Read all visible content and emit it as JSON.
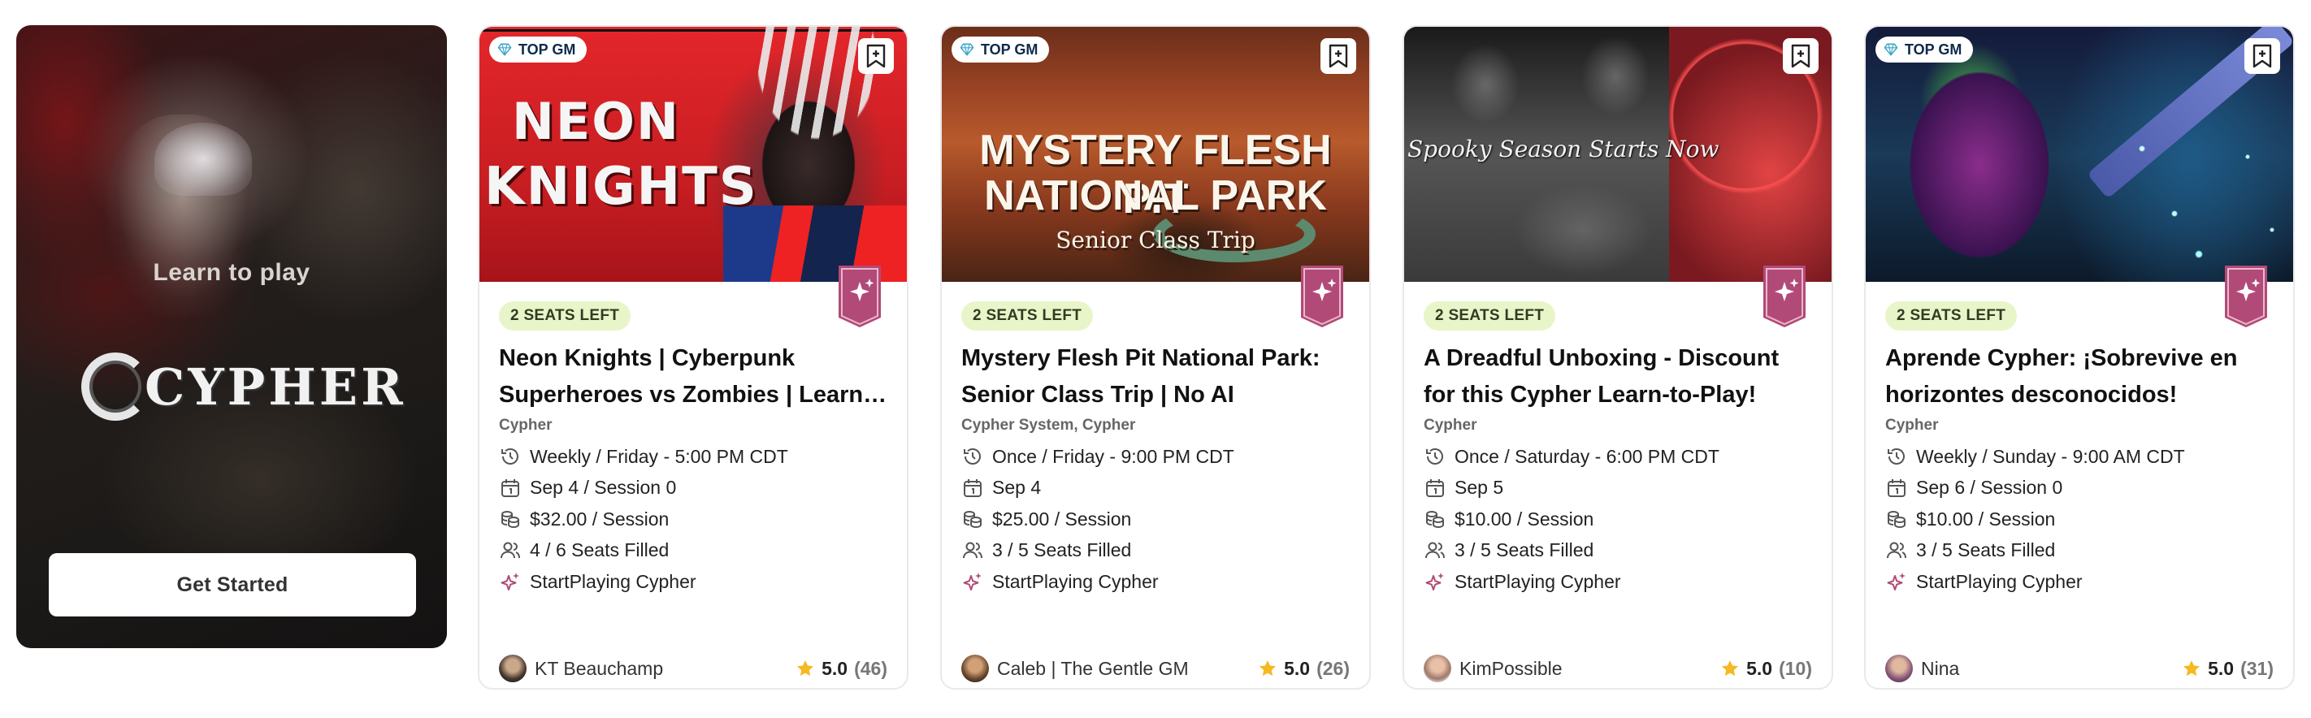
{
  "promo": {
    "tagline": "Learn to play",
    "logo_text": "CYPHER",
    "cta_label": "Get Started"
  },
  "cards": [
    {
      "badge": "TOP GM",
      "seats": "2 SEATS LEFT",
      "title": "Neon Knights | Cyberpunk Superheroes vs Zombies | Learn-to-Play",
      "system": "Cypher",
      "schedule": "Weekly / Friday - 5:00 PM CDT",
      "date": "Sep 4 / Session 0",
      "price": "$32.00 / Session",
      "filled": "4 / 6 Seats Filled",
      "host": "StartPlaying Cypher",
      "gm": "KT Beauchamp",
      "rating": "5.0",
      "reviews": "(46)",
      "art": {
        "line1": "NEON",
        "line2": "KNIGHTS"
      }
    },
    {
      "badge": "TOP GM",
      "seats": "2 SEATS LEFT",
      "title": "Mystery Flesh Pit National Park: Senior Class Trip | No AI",
      "system": "Cypher System, Cypher",
      "schedule": "Once / Friday - 9:00 PM CDT",
      "date": "Sep 4",
      "price": "$25.00 / Session",
      "filled": "3 / 5 Seats Filled",
      "host": "StartPlaying Cypher",
      "gm": "Caleb | The Gentle GM",
      "rating": "5.0",
      "reviews": "(26)",
      "art": {
        "line1": "MYSTERY FLESH PIT",
        "line2": "NATIONAL PARK",
        "line3": "Senior Class Trip"
      }
    },
    {
      "badge": "",
      "seats": "2 SEATS LEFT",
      "title": "A Dreadful Unboxing - Discount for this Cypher Learn-to-Play!",
      "system": "Cypher",
      "schedule": "Once / Saturday - 6:00 PM CDT",
      "date": "Sep 5",
      "price": "$10.00 / Session",
      "filled": "3 / 5 Seats Filled",
      "host": "StartPlaying Cypher",
      "gm": "KimPossible",
      "rating": "5.0",
      "reviews": "(10)",
      "art": {
        "line1": "Spooky Season Starts Now"
      }
    },
    {
      "badge": "TOP GM",
      "seats": "2 SEATS LEFT",
      "title": "Aprende Cypher: ¡Sobrevive en horizontes desconocidos!",
      "system": "Cypher",
      "schedule": "Weekly / Sunday - 9:00 AM CDT",
      "date": "Sep 6 / Session 0",
      "price": "$10.00 / Session",
      "filled": "3 / 5 Seats Filled",
      "host": "StartPlaying Cypher",
      "gm": "Nina",
      "rating": "5.0",
      "reviews": "(31)",
      "art": {}
    }
  ],
  "icons": {
    "top_gm": "diamond-icon",
    "bookmark": "bookmark-icon",
    "ribbon": "sparkle-ribbon-icon",
    "schedule": "clock-history-icon",
    "date": "calendar-icon",
    "price": "coins-icon",
    "filled": "users-icon",
    "host": "sparkle-icon",
    "rating": "star-icon"
  },
  "colors": {
    "seats_badge_bg": "#e8f5c8",
    "ribbon": "#b24a78",
    "star": "#f5b921",
    "top_gm_text": "#0d2a4a"
  }
}
